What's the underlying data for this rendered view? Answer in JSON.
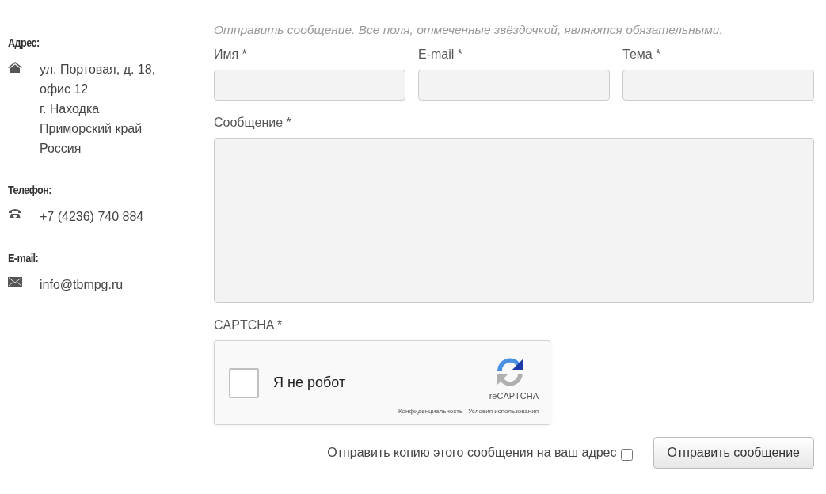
{
  "contacts": [
    {
      "heading": "Адрес:",
      "kind": "home",
      "lines": [
        "ул. Портовая, д. 18,",
        "офис 12",
        "г. Находка",
        "Приморский край",
        "Россия"
      ]
    },
    {
      "heading": "Телефон:",
      "kind": "phone",
      "lines": [
        "+7 (4236) 740 884"
      ]
    },
    {
      "heading": "E-mail:",
      "kind": "mail",
      "lines": [
        "info@tbmpg.ru"
      ]
    }
  ],
  "form": {
    "intro": "Отправить сообщение. Все поля, отмеченные звёздочкой, являются обязательными.",
    "fields": [
      {
        "label": "Имя *",
        "kind": "text"
      },
      {
        "label": "E-mail *",
        "kind": "text"
      },
      {
        "label": "Тема *",
        "kind": "text"
      },
      {
        "label": "Сообщение *",
        "kind": "textarea"
      }
    ],
    "captcha_label": "CAPTCHA *",
    "recaptcha": {
      "label": "Я не робот",
      "checked": false,
      "brand": "reCAPTCHA",
      "links": "Конфиденциальность - Условия использования"
    },
    "copy": {
      "label": "Отправить копию этого сообщения на ваш адрес",
      "checked": false
    },
    "submit": "Отправить сообщение"
  }
}
